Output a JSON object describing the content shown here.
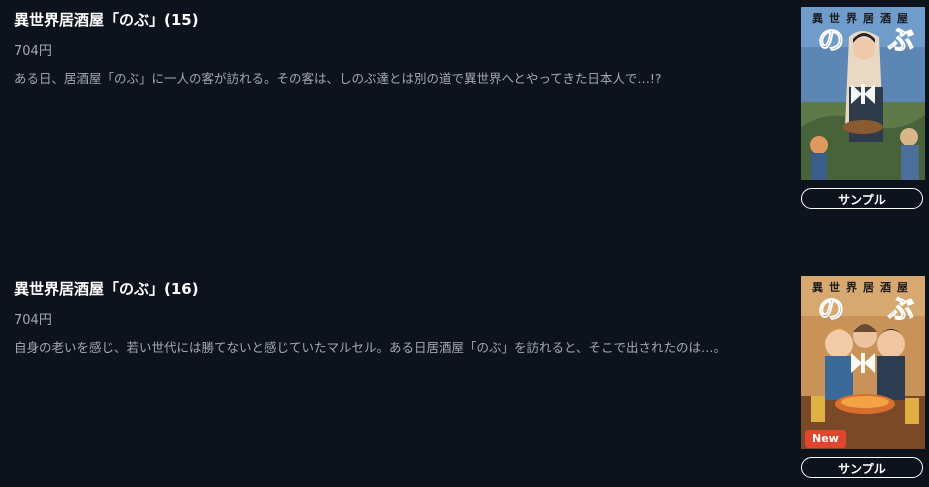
{
  "items": [
    {
      "title": "異世界居酒屋「のぶ」(15)",
      "price": "704円",
      "description": "ある日、居酒屋「のぶ」に一人の客が訪れる。その客は、しのぶ達とは別の道で異世界へとやってきた日本人で…!?",
      "sample_label": "サンプル",
      "cover": {
        "title_text": "異世界居酒屋",
        "logo_text": "のぶ",
        "play_icon": "play-pause-icon"
      }
    },
    {
      "title": "異世界居酒屋「のぶ」(16)",
      "price": "704円",
      "description": "自身の老いを感じ、若い世代には勝てないと感じていたマルセル。ある日居酒屋「のぶ」を訪れると、そこで出されたのは…。",
      "sample_label": "サンプル",
      "badge": "New",
      "cover": {
        "title_text": "異世界居酒屋",
        "logo_text": "のぶ",
        "play_icon": "play-pause-icon"
      }
    }
  ],
  "colors": {
    "background": "#0c131d",
    "text_primary": "#ffffff",
    "text_secondary": "#a3a9b1",
    "badge_new": "#e1452e"
  }
}
